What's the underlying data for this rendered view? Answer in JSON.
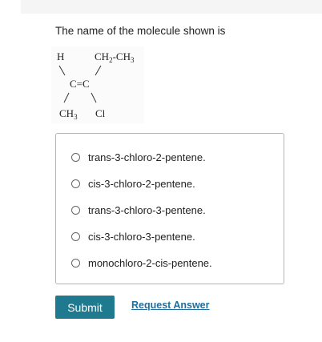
{
  "question": {
    "text": "The name of the molecule shown is"
  },
  "molecule": {
    "top_left": "H",
    "top_right_a": "CH",
    "top_right_a_sub": "2",
    "top_right_dash": "-",
    "top_right_b": "CH",
    "top_right_b_sub": "3",
    "center_left": "C",
    "center_bond": "=",
    "center_right": "C",
    "bottom_left": "CH",
    "bottom_left_sub": "3",
    "bottom_right": "Cl"
  },
  "options": [
    {
      "label": "trans-3-chloro-2-pentene."
    },
    {
      "label": "cis-3-chloro-2-pentene."
    },
    {
      "label": "trans-3-chloro-3-pentene."
    },
    {
      "label": "cis-3-chloro-3-pentene."
    },
    {
      "label": "monochloro-2-cis-pentene."
    }
  ],
  "actions": {
    "submit_label": "Submit",
    "request_answer_label": "Request Answer"
  },
  "colors": {
    "submit_background": "#1f7a8f",
    "link": "#1f6f9e",
    "border": "#b5b5b5"
  }
}
